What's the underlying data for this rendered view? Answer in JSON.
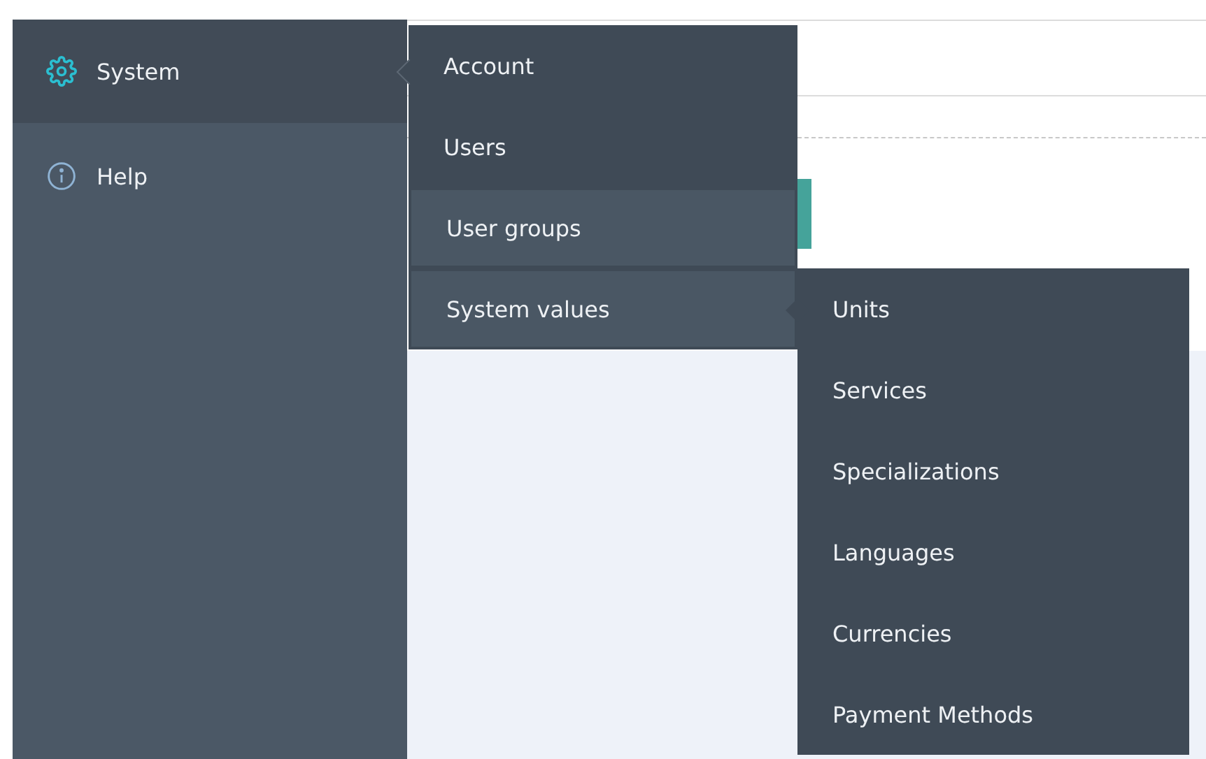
{
  "sidebar": {
    "items": [
      {
        "label": "System",
        "kind": "gear",
        "selected": true
      },
      {
        "label": "Help",
        "kind": "info",
        "selected": false
      }
    ]
  },
  "submenu": {
    "items": [
      {
        "label": "Account",
        "highlighted": false
      },
      {
        "label": "Users",
        "highlighted": false
      },
      {
        "label": "User groups",
        "highlighted": true
      },
      {
        "label": "System values",
        "highlighted": true
      }
    ]
  },
  "system_values_menu": {
    "items": [
      {
        "label": "Units"
      },
      {
        "label": "Services"
      },
      {
        "label": "Specializations"
      },
      {
        "label": "Languages"
      },
      {
        "label": "Currencies"
      },
      {
        "label": "Payment Methods"
      }
    ]
  }
}
